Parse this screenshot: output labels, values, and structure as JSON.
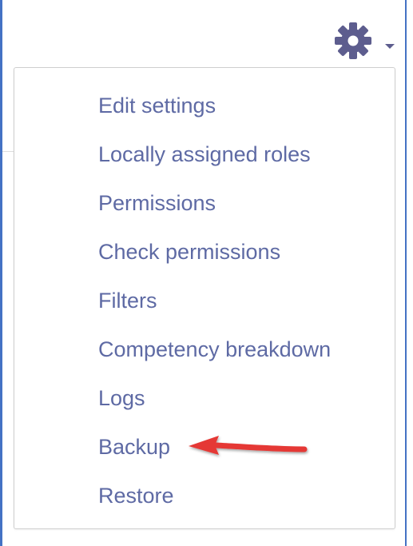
{
  "menu": {
    "items": [
      {
        "label": "Edit settings"
      },
      {
        "label": "Locally assigned roles"
      },
      {
        "label": "Permissions"
      },
      {
        "label": "Check permissions"
      },
      {
        "label": "Filters"
      },
      {
        "label": "Competency breakdown"
      },
      {
        "label": "Logs"
      },
      {
        "label": "Backup"
      },
      {
        "label": "Restore"
      }
    ]
  },
  "icons": {
    "settings": "gear-icon",
    "toggle": "caret-down-icon",
    "annotation": "red-arrow-icon"
  },
  "colors": {
    "link": "#5e6aa4",
    "gear": "#5d5d8e",
    "annotation": "#e53935",
    "frame": "#4472c4"
  }
}
